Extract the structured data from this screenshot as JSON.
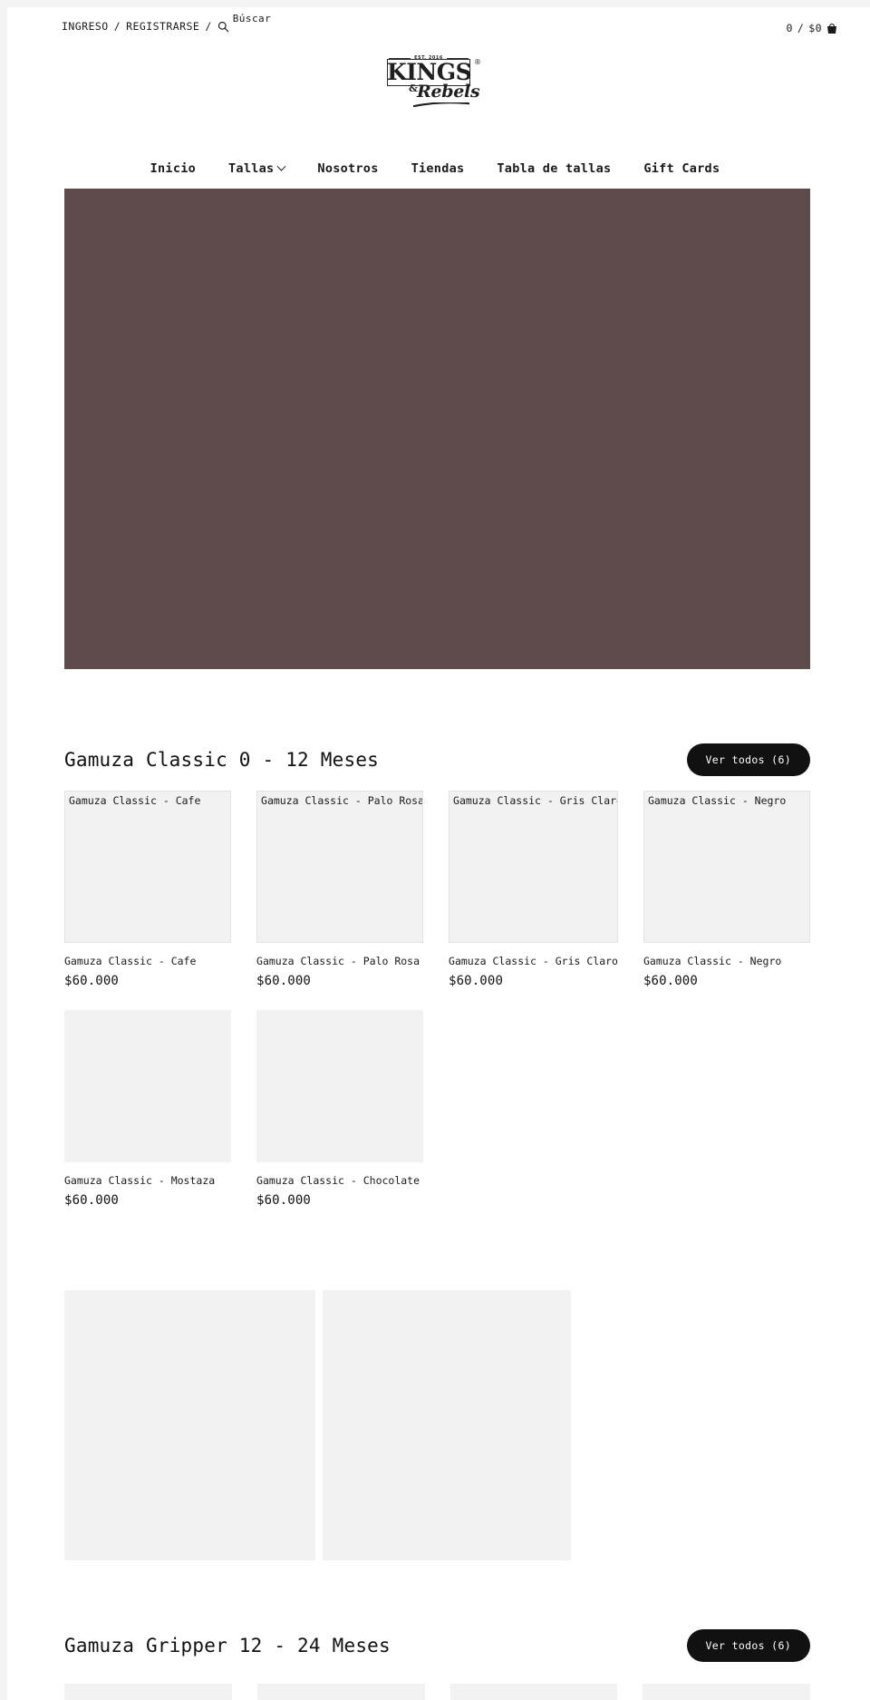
{
  "utility_bar": {
    "login": "INGRESO",
    "separator_1": "/",
    "register": "REGISTRARSE",
    "separator_2": "/",
    "search_icon": "search-icon",
    "search_label": "Búscar",
    "cart_count": "0",
    "cart_separator": "/",
    "cart_total": "$0",
    "cart_icon": "shopping-cart-icon"
  },
  "logo": {
    "est": "EST. 2016",
    "name_top": "KINGS",
    "ampersand": "&",
    "name_bottom": "Rebels",
    "registered": "®"
  },
  "nav": {
    "items": [
      {
        "label": "Inicio",
        "has_caret": false
      },
      {
        "label": "Tallas",
        "has_caret": true
      },
      {
        "label": "Nosotros",
        "has_caret": false
      },
      {
        "label": "Tiendas",
        "has_caret": false
      },
      {
        "label": "Tabla de tallas",
        "has_caret": false
      },
      {
        "label": "Gift Cards",
        "has_caret": false
      }
    ]
  },
  "hero": {
    "background_color": "#5e4b4b",
    "name": "hero-banner"
  },
  "colors": {
    "accent": "#111111",
    "hero_brown": "#5e4b4b",
    "placeholder_gray": "#f2f2f2",
    "page_edge_gray": "#f4f4f4"
  },
  "sections": [
    {
      "title": "Gamuza Classic 0 - 12 Meses",
      "view_all": "Ver todos (6)",
      "products": [
        {
          "name": "Gamuza Classic - Cafe",
          "alt": "Gamuza Classic - Cafe",
          "price": "$60.000",
          "broken": true
        },
        {
          "name": "Gamuza Classic - Palo Rosa",
          "alt": "Gamuza Classic - Palo Rosa",
          "price": "$60.000",
          "broken": true
        },
        {
          "name": "Gamuza Classic - Gris Claro",
          "alt": "Gamuza Classic - Gris Claro",
          "price": "$60.000",
          "broken": true
        },
        {
          "name": "Gamuza Classic - Negro",
          "alt": "Gamuza Classic - Negro",
          "price": "$60.000",
          "broken": true
        },
        {
          "name": "Gamuza Classic - Mostaza",
          "alt": "",
          "price": "$60.000",
          "broken": false
        },
        {
          "name": "Gamuza Classic - Chocolate",
          "alt": "",
          "price": "$60.000",
          "broken": false
        }
      ]
    },
    {
      "title": "Gamuza Gripper 12 - 24 Meses",
      "view_all": "Ver todos (6)",
      "products": []
    }
  ]
}
